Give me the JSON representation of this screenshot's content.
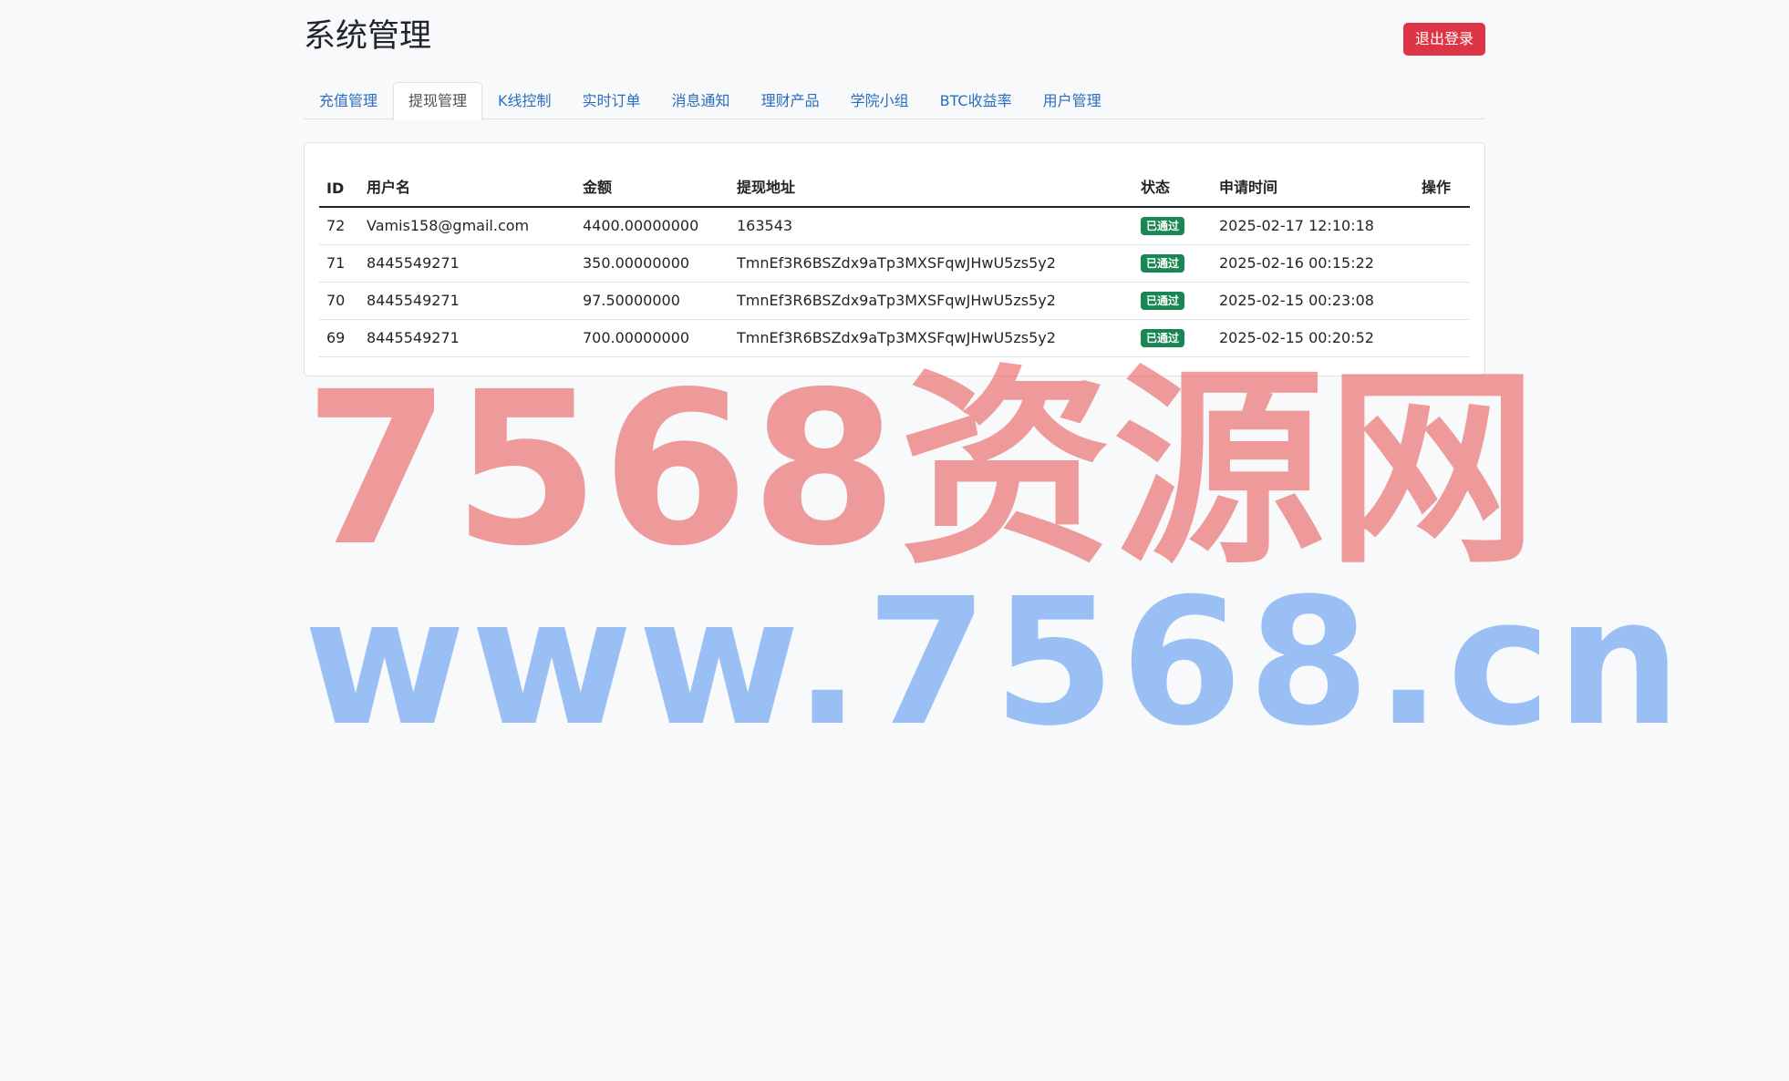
{
  "header": {
    "title": "系统管理",
    "logout_label": "退出登录"
  },
  "tabs": [
    {
      "label": "充值管理",
      "active": false
    },
    {
      "label": "提现管理",
      "active": true
    },
    {
      "label": "K线控制",
      "active": false
    },
    {
      "label": "实时订单",
      "active": false
    },
    {
      "label": "消息通知",
      "active": false
    },
    {
      "label": "理财产品",
      "active": false
    },
    {
      "label": "学院小组",
      "active": false
    },
    {
      "label": "BTC收益率",
      "active": false
    },
    {
      "label": "用户管理",
      "active": false
    }
  ],
  "table": {
    "columns": [
      "ID",
      "用户名",
      "金额",
      "提现地址",
      "状态",
      "申请时间",
      "操作"
    ],
    "rows": [
      {
        "id": "72",
        "username": "Vamis158@gmail.com",
        "amount": "4400.00000000",
        "address": "163543",
        "status": "已通过",
        "time": "2025-02-17 12:10:18",
        "action": ""
      },
      {
        "id": "71",
        "username": "8445549271",
        "amount": "350.00000000",
        "address": "TmnEf3R6BSZdx9aTp3MXSFqwJHwU5zs5y2",
        "status": "已通过",
        "time": "2025-02-16 00:15:22",
        "action": ""
      },
      {
        "id": "70",
        "username": "8445549271",
        "amount": "97.50000000",
        "address": "TmnEf3R6BSZdx9aTp3MXSFqwJHwU5zs5y2",
        "status": "已通过",
        "time": "2025-02-15 00:23:08",
        "action": ""
      },
      {
        "id": "69",
        "username": "8445549271",
        "amount": "700.00000000",
        "address": "TmnEf3R6BSZdx9aTp3MXSFqwJHwU5zs5y2",
        "status": "已通过",
        "time": "2025-02-15 00:20:52",
        "action": ""
      }
    ]
  },
  "watermark": {
    "line1": "7568资源网",
    "line2": "www.7568.cn"
  },
  "colors": {
    "danger": "#dc3545",
    "success": "#198754",
    "link": "#2a6ebd",
    "background": "#f8f9fa"
  }
}
